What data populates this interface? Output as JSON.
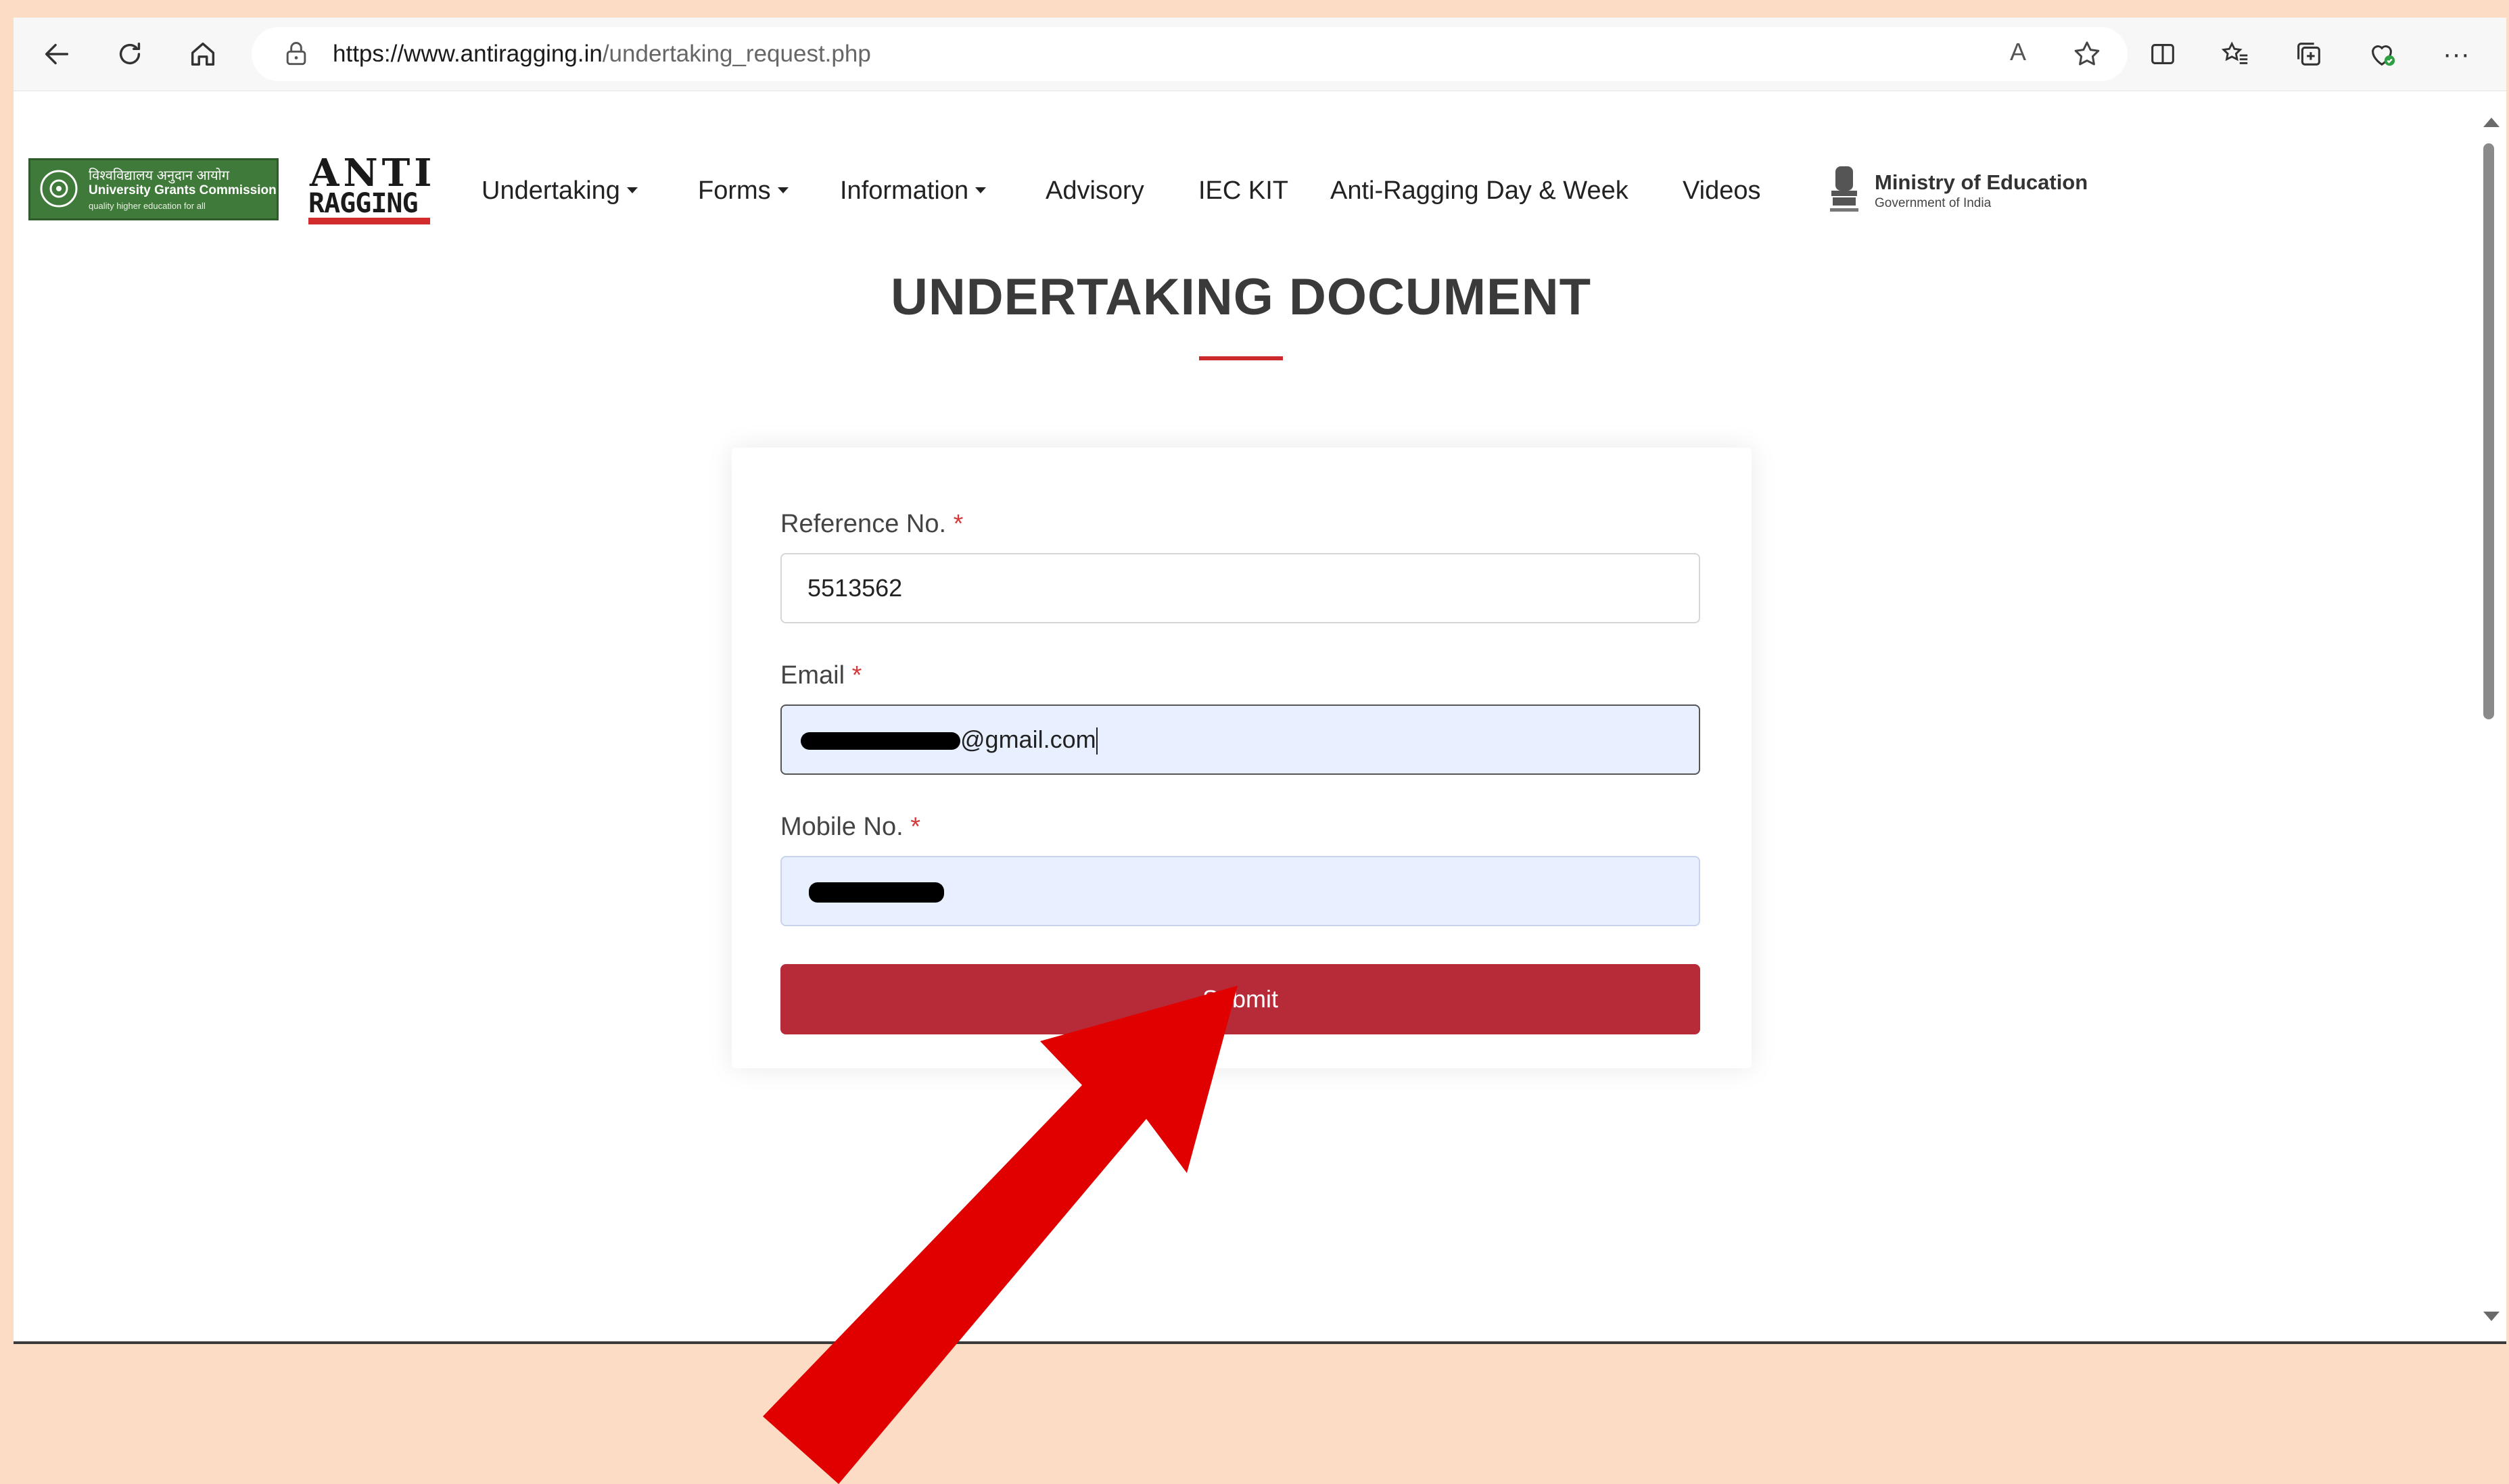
{
  "browser": {
    "url_host": "https://www.antiragging.in",
    "url_path": "/undertaking_request.php",
    "icons": {
      "back": "back-arrow-icon",
      "refresh": "refresh-icon",
      "home": "home-icon",
      "lock": "lock-icon",
      "read_aloud": "read-aloud-icon",
      "favorite": "star-icon",
      "split": "split-screen-icon",
      "favorites": "favorites-icon",
      "collections": "collections-icon",
      "health": "browser-essentials-icon",
      "more": "more-icon"
    },
    "read_aloud_label": "A",
    "more_label": "···"
  },
  "site": {
    "ugc_logo": {
      "hindi": "विश्वविद्यालय अनुदान आयोग",
      "english": "University Grants Commission",
      "tagline": "quality higher education for all"
    },
    "anti_logo": {
      "line1": "ANTI",
      "line2": "RAGGING"
    },
    "nav": [
      {
        "label": "Undertaking",
        "dropdown": true
      },
      {
        "label": "Forms",
        "dropdown": true
      },
      {
        "label": "Information",
        "dropdown": true
      },
      {
        "label": "Advisory",
        "dropdown": false
      },
      {
        "label": "IEC KIT",
        "dropdown": false
      },
      {
        "label": "Anti-Ragging Day & Week",
        "dropdown": false
      },
      {
        "label": "Videos",
        "dropdown": false
      }
    ],
    "ministry": {
      "title": "Ministry of Education",
      "subtitle": "Government of India"
    }
  },
  "page": {
    "title": "UNDERTAKING DOCUMENT",
    "accent": "#cc2a2a"
  },
  "form": {
    "reference": {
      "label": "Reference No.",
      "required": "*",
      "value": "5513562"
    },
    "email": {
      "label": "Email",
      "required": "*",
      "value_visible": "@gmail.com"
    },
    "mobile": {
      "label": "Mobile No.",
      "required": "*"
    },
    "submit_label": "Submit",
    "submit_color": "#b72a37"
  },
  "annotation": {
    "arrow_color": "#e00000"
  }
}
